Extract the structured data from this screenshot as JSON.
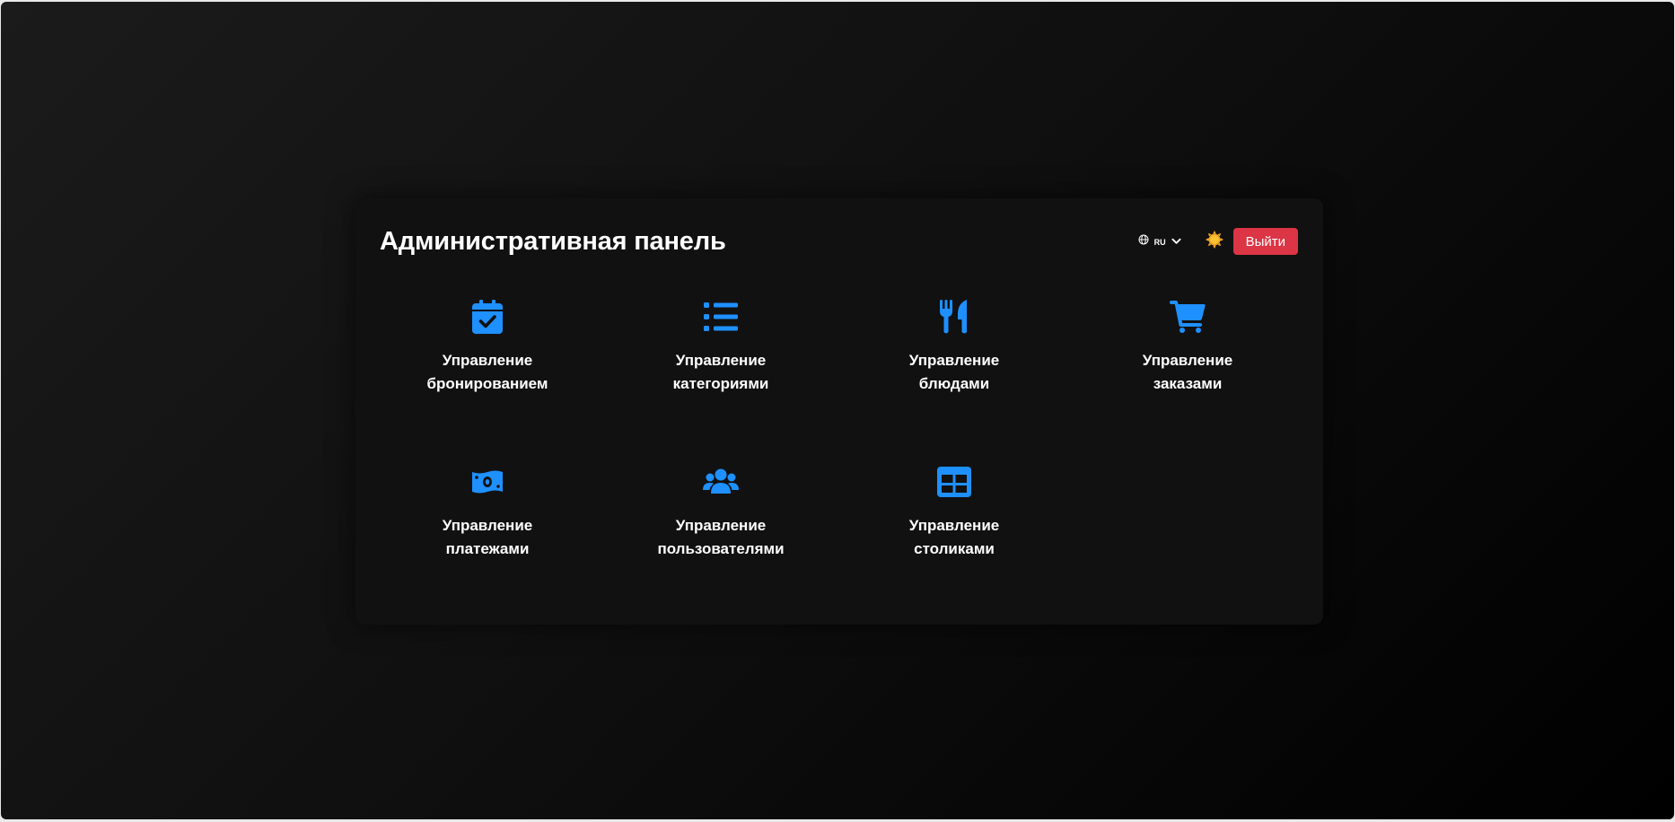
{
  "header": {
    "title": "Административная панель",
    "language": {
      "code": "RU",
      "icon": "globe-icon",
      "chevron": "chevron-down-icon"
    },
    "theme_toggle": {
      "icon": "sun-icon",
      "color": "#f5a623"
    },
    "logout_label": "Выйти",
    "logout_color": "#dc3545"
  },
  "accent_color": "#1e90ff",
  "tiles": [
    {
      "icon": "calendar-check-icon",
      "line1": "Управление",
      "line2": "бронированием"
    },
    {
      "icon": "list-icon",
      "line1": "Управление",
      "line2": "категориями"
    },
    {
      "icon": "utensils-icon",
      "line1": "Управление",
      "line2": "блюдами"
    },
    {
      "icon": "shopping-cart-icon",
      "line1": "Управление",
      "line2": "заказами"
    },
    {
      "icon": "money-bill-icon",
      "line1": "Управление",
      "line2": "платежами"
    },
    {
      "icon": "users-icon",
      "line1": "Управление",
      "line2": "пользователями"
    },
    {
      "icon": "table-icon",
      "line1": "Управление",
      "line2": "столиками"
    }
  ]
}
